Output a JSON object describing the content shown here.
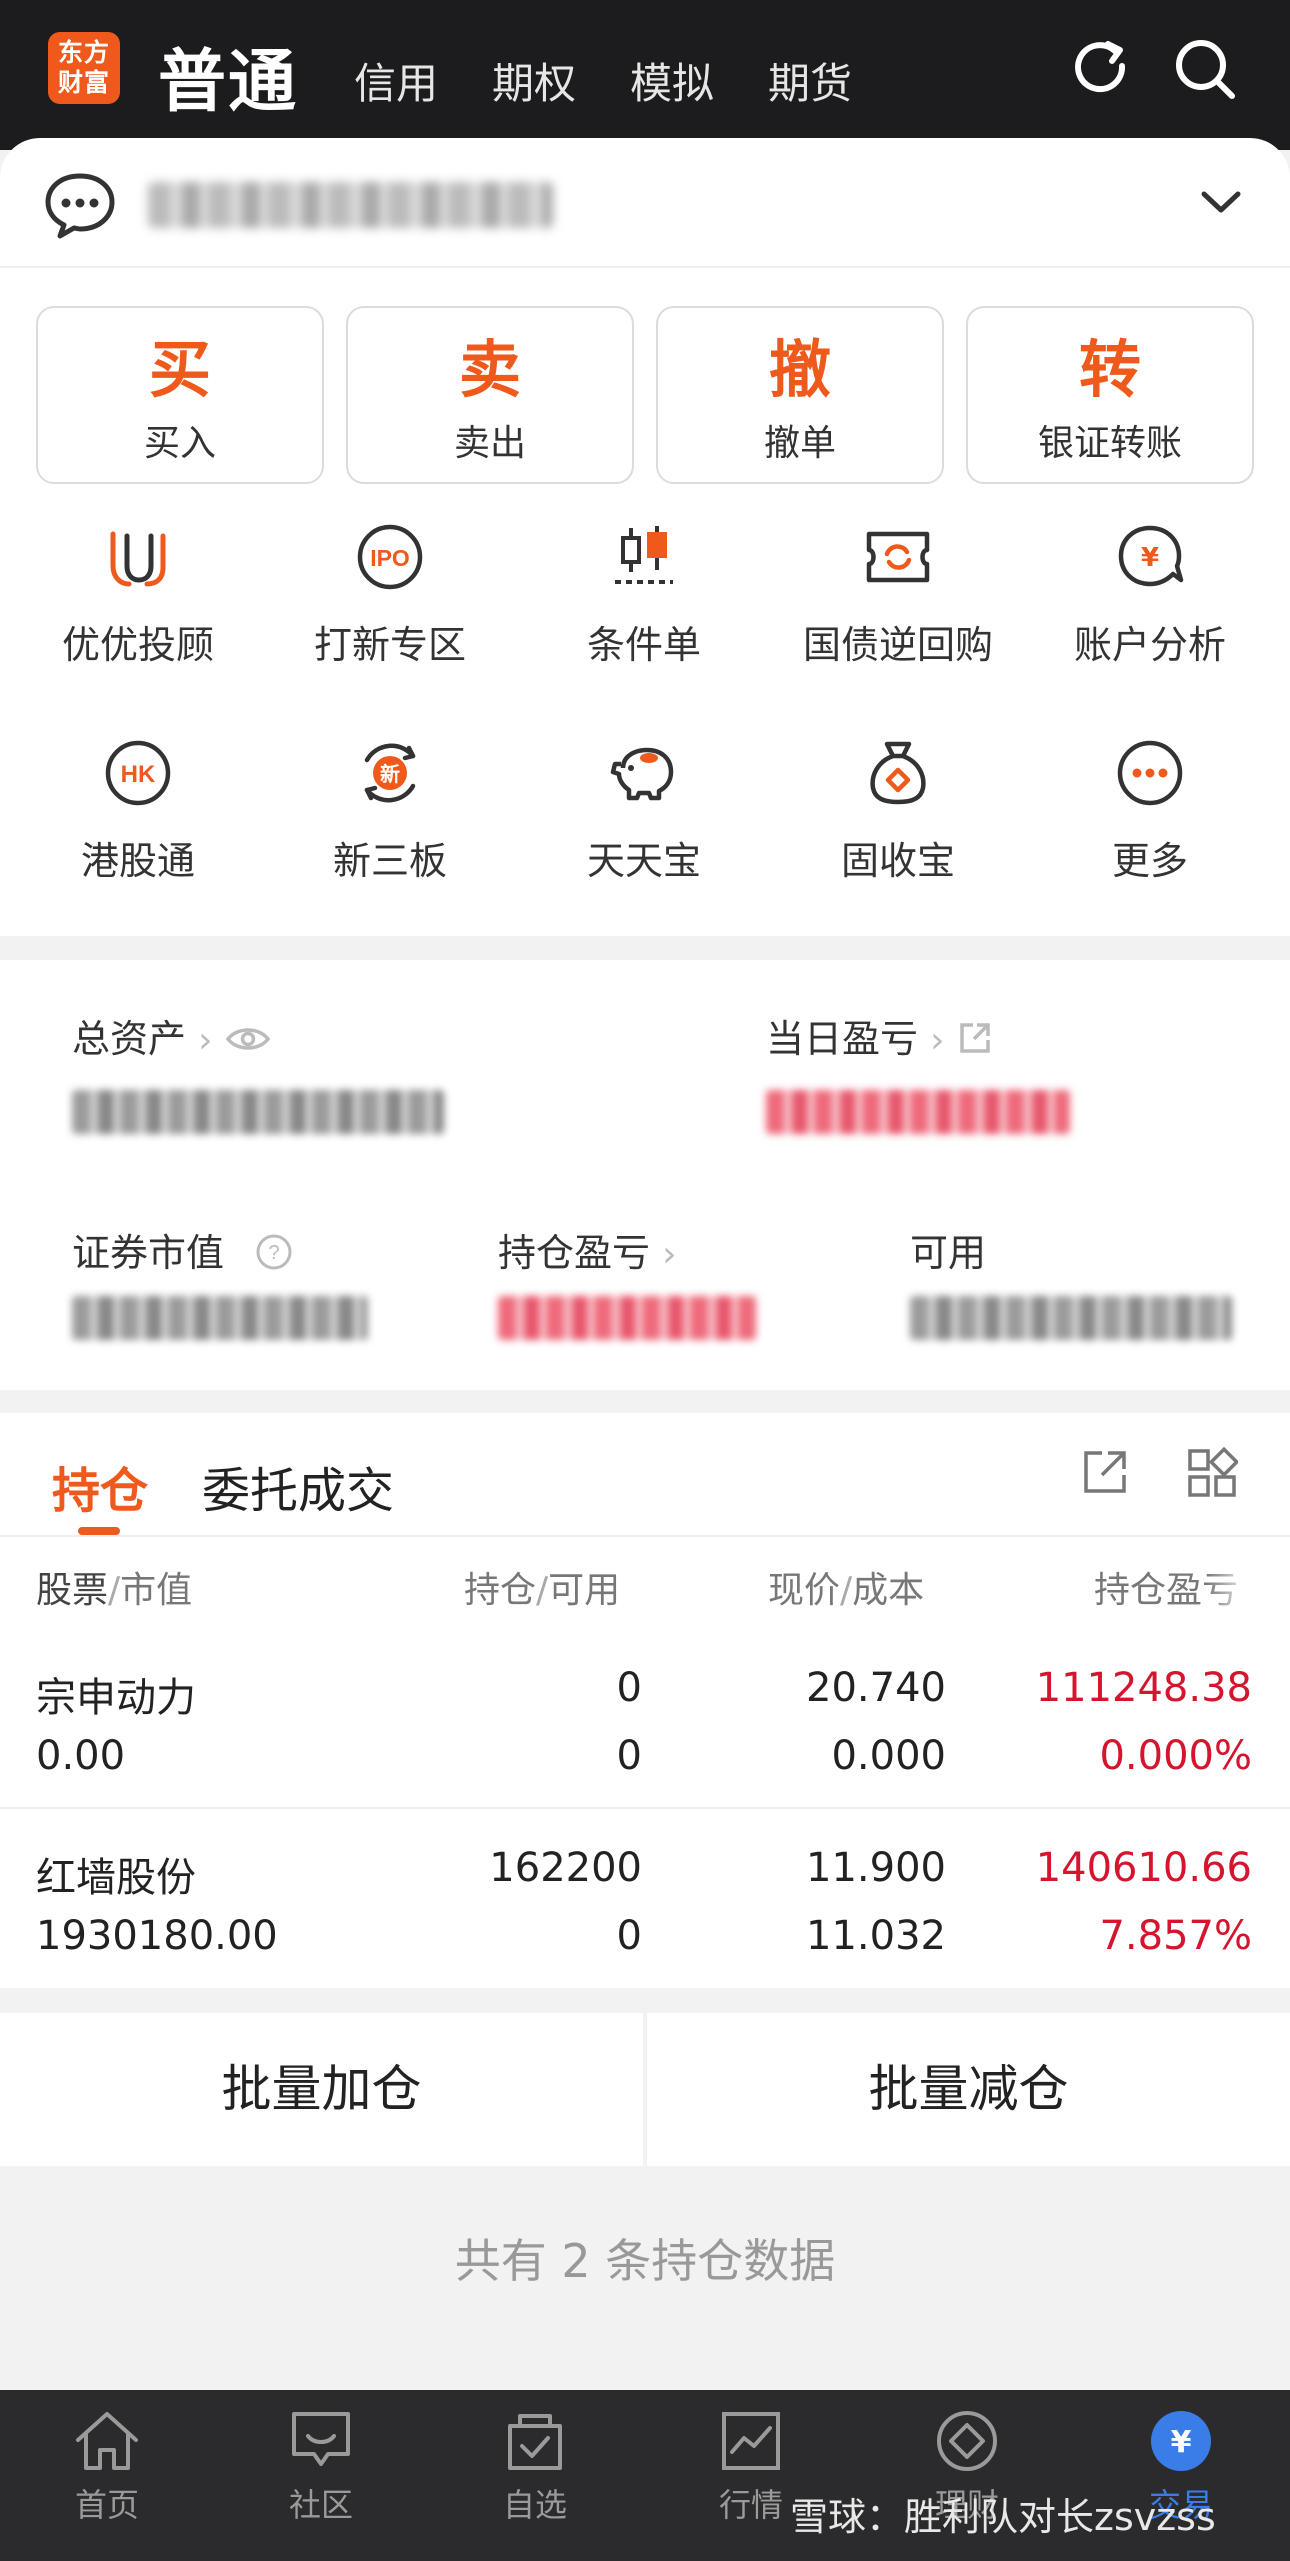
{
  "topbar": {
    "logo_line1": "东方",
    "logo_line2": "财富",
    "tabs": [
      "普通",
      "信用",
      "期权",
      "模拟",
      "期货"
    ],
    "refresh_icon": "refresh-icon",
    "search_icon": "search-icon"
  },
  "account": {
    "chat_icon": "chat-bubble-icon",
    "dropdown_icon": "chevron-down-icon"
  },
  "actions": [
    {
      "big": "买",
      "label": "买入"
    },
    {
      "big": "卖",
      "label": "卖出"
    },
    {
      "big": "撤",
      "label": "撤单"
    },
    {
      "big": "转",
      "label": "银证转账"
    }
  ],
  "grid": [
    {
      "label": "优优投顾",
      "icon": "uu-advisor-icon"
    },
    {
      "label": "打新专区",
      "icon": "ipo-icon"
    },
    {
      "label": "条件单",
      "icon": "candlestick-icon"
    },
    {
      "label": "国债逆回购",
      "icon": "bond-repo-icon"
    },
    {
      "label": "账户分析",
      "icon": "account-analysis-icon"
    },
    {
      "label": "港股通",
      "icon": "hk-icon"
    },
    {
      "label": "新三板",
      "icon": "new-third-board-icon"
    },
    {
      "label": "天天宝",
      "icon": "piggy-bank-icon"
    },
    {
      "label": "固收宝",
      "icon": "money-bag-icon"
    },
    {
      "label": "更多",
      "icon": "more-icon"
    }
  ],
  "assets": {
    "total_label": "总资产",
    "daily_pl_label": "当日盈亏",
    "market_value_label": "证券市值",
    "position_pl_label": "持仓盈亏",
    "available_label": "可用"
  },
  "holdings": {
    "tabs": [
      "持仓",
      "委托成交"
    ],
    "headers": {
      "stock": "股票",
      "market_value": "市值",
      "position": "持仓",
      "available": "可用",
      "price": "现价",
      "cost": "成本",
      "pl": "持仓盈亏"
    },
    "rows": [
      {
        "name": "宗申动力",
        "market_value": "0.00",
        "position": "0",
        "available": "0",
        "price": "20.740",
        "cost": "0.000",
        "pl": "111248.38",
        "pl_pct": "0.000%"
      },
      {
        "name": "红墙股份",
        "market_value": "1930180.00",
        "position": "162200",
        "available": "0",
        "price": "11.900",
        "cost": "11.032",
        "pl": "140610.66",
        "pl_pct": "7.857%"
      }
    ]
  },
  "batch": {
    "add": "批量加仓",
    "reduce": "批量减仓"
  },
  "footer_note": "共有 2 条持仓数据",
  "nav": [
    {
      "label": "首页",
      "icon": "home-icon"
    },
    {
      "label": "社区",
      "icon": "community-icon"
    },
    {
      "label": "自选",
      "icon": "watchlist-icon"
    },
    {
      "label": "行情",
      "icon": "market-chart-icon"
    },
    {
      "label": "理财",
      "icon": "wealth-icon"
    },
    {
      "label": "交易",
      "icon": "trade-yuan-icon"
    }
  ],
  "watermark": "雪球：胜利队对长zsvzss",
  "colors": {
    "accent": "#ef5a1c",
    "profit_red": "#d5142e",
    "nav_active": "#3b7de8"
  }
}
